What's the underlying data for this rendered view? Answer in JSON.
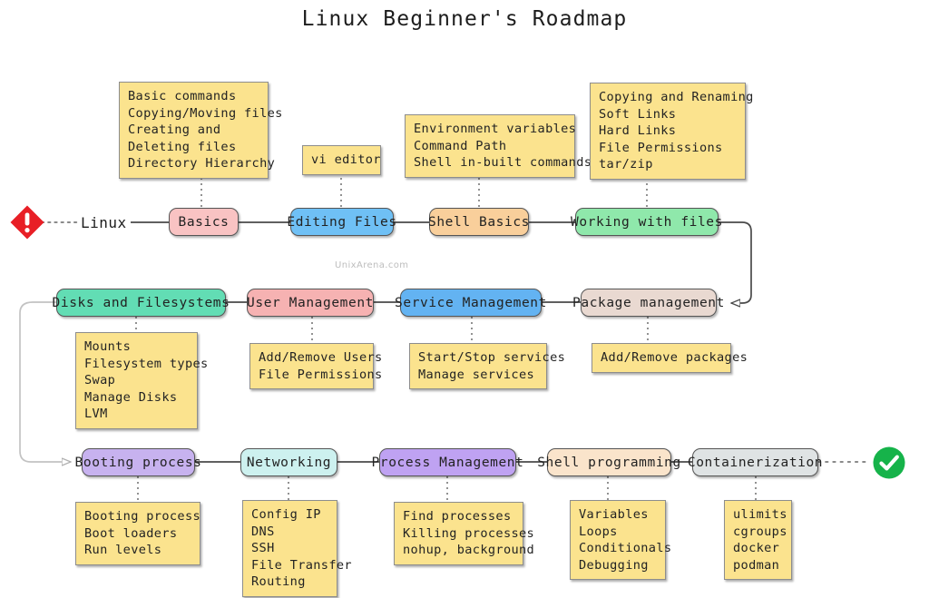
{
  "title": "Linux Beginner's Roadmap",
  "watermark": "UnixArena.com",
  "root": {
    "label": "Linux",
    "start_icon": "alert-diamond-icon",
    "end_icon": "check-circle-icon",
    "start_color": "#e81f26",
    "end_color": "#16b34a"
  },
  "colors": {
    "basics": "#f9c3c3",
    "editing_files": "#6fc0f5",
    "shell_basics": "#f9cf9b",
    "working_with_files": "#8fe8ab",
    "disks_and_filesystems": "#62ddb4",
    "user_management": "#f6b2b2",
    "service_management": "#63b3f2",
    "package_management": "#e9d9d1",
    "booting_process": "#c7b2ef",
    "networking": "#cdf1ef",
    "process_management": "#bfa2f2",
    "shell_programming": "#fae4cb",
    "containerization": "#dfe3e4",
    "note_fill": "#fbe38e",
    "note_border": "#8d8d8d",
    "node_border": "#555555",
    "edge": "#4a4a4a",
    "edge_light": "#b9b9b9"
  },
  "rows": [
    {
      "id": "row-1",
      "nodes": [
        {
          "id": "basics",
          "label": "Basics",
          "note": "Basic commands\nCopying/Moving files\nCreating and\nDeleting files\nDirectory Hierarchy"
        },
        {
          "id": "editing-files",
          "label": "Editing Files",
          "note": "vi editor"
        },
        {
          "id": "shell-basics",
          "label": "Shell Basics",
          "note": "Environment variables\nCommand Path\nShell in-built commands"
        },
        {
          "id": "working-with-files",
          "label": "Working with files",
          "note": "Copying and Renaming\nSoft Links\nHard Links\nFile Permissions\ntar/zip"
        }
      ]
    },
    {
      "id": "row-2",
      "nodes": [
        {
          "id": "disks-and-filesystems",
          "label": "Disks and Filesystems",
          "note": "Mounts\nFilesystem types\nSwap\nManage Disks\nLVM"
        },
        {
          "id": "user-management",
          "label": "User Management",
          "note": "Add/Remove Users\nFile Permissions"
        },
        {
          "id": "service-management",
          "label": "Service Management",
          "note": "Start/Stop services\nManage services"
        },
        {
          "id": "package-management",
          "label": "Package management",
          "note": "Add/Remove packages"
        }
      ]
    },
    {
      "id": "row-3",
      "nodes": [
        {
          "id": "booting-process",
          "label": "Booting process",
          "note": "Booting process\nBoot loaders\nRun levels"
        },
        {
          "id": "networking",
          "label": "Networking",
          "note": "Config IP\nDNS\nSSH\nFile Transfer\nRouting"
        },
        {
          "id": "process-management",
          "label": "Process Management",
          "note": "Find processes\nKilling processes\nnohup, background"
        },
        {
          "id": "shell-programming",
          "label": "Shell programming",
          "note": "Variables\nLoops\nConditionals\nDebugging"
        },
        {
          "id": "containerization",
          "label": "Containerization",
          "note": "ulimits\ncgroups\ndocker\npodman"
        }
      ]
    }
  ]
}
